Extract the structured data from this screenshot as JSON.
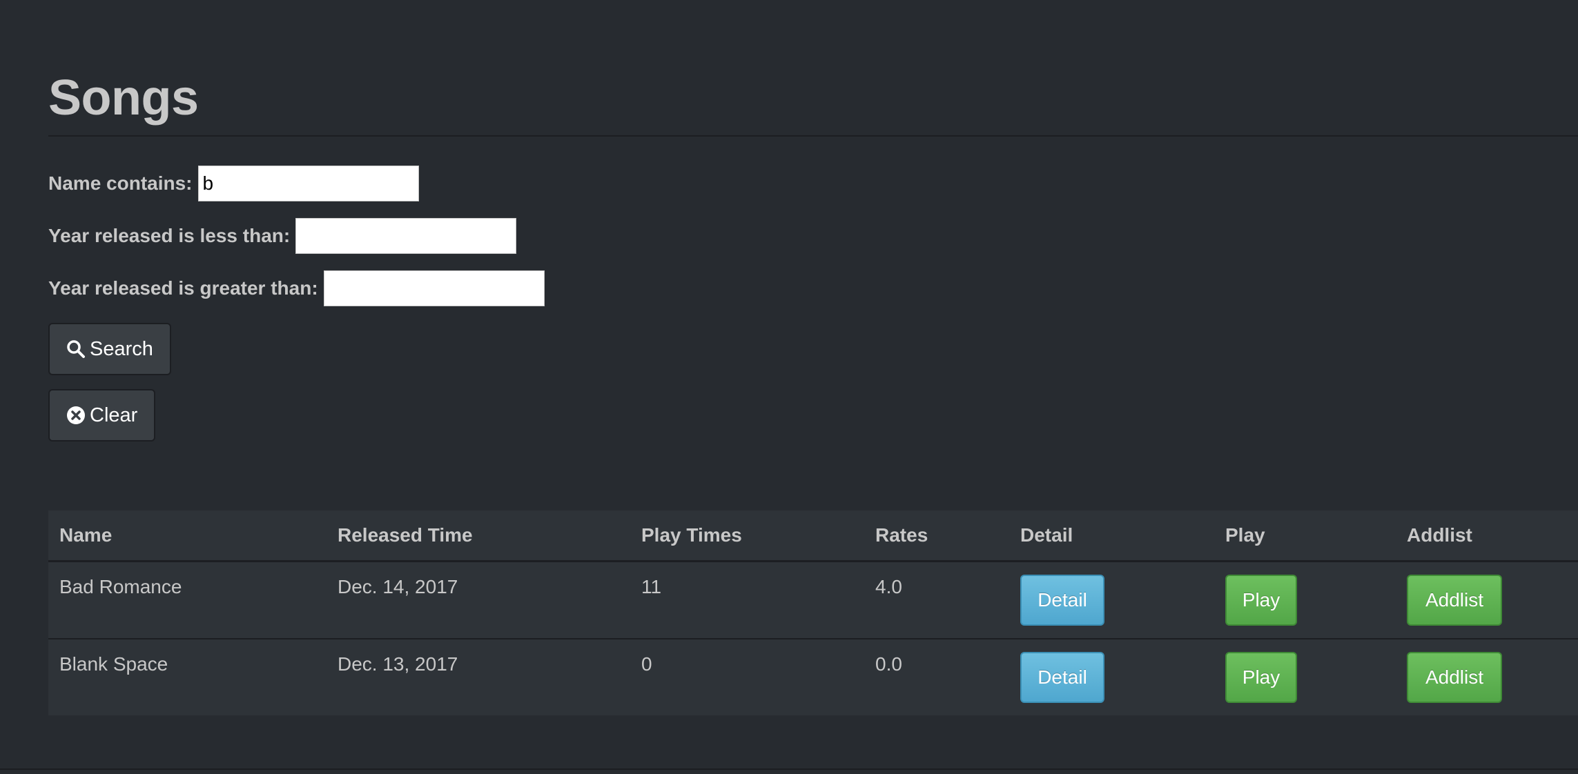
{
  "header": {
    "title": "Songs"
  },
  "filters": {
    "name": {
      "label": "Name contains:",
      "value": "b"
    },
    "year_lt": {
      "label": "Year released is less than:",
      "value": ""
    },
    "year_gt": {
      "label": "Year released is greater than:",
      "value": ""
    }
  },
  "buttons": {
    "search": "Search",
    "clear": "Clear"
  },
  "table": {
    "headers": [
      "Name",
      "Released Time",
      "Play Times",
      "Rates",
      "Detail",
      "Play",
      "Addlist"
    ],
    "rows": [
      {
        "name": "Bad Romance",
        "released": "Dec. 14, 2017",
        "play_times": "11",
        "rates": "4.0",
        "detail": "Detail",
        "play": "Play",
        "addlist": "Addlist"
      },
      {
        "name": "Blank Space",
        "released": "Dec. 13, 2017",
        "play_times": "0",
        "rates": "0.0",
        "detail": "Detail",
        "play": "Play",
        "addlist": "Addlist"
      }
    ]
  },
  "icons": {
    "search_button": "search-icon",
    "clear_button": "times-circle-icon"
  },
  "colors": {
    "background": "#272b30",
    "table_bg": "#2e3338",
    "info": "#5bc0de",
    "success": "#62c462"
  }
}
